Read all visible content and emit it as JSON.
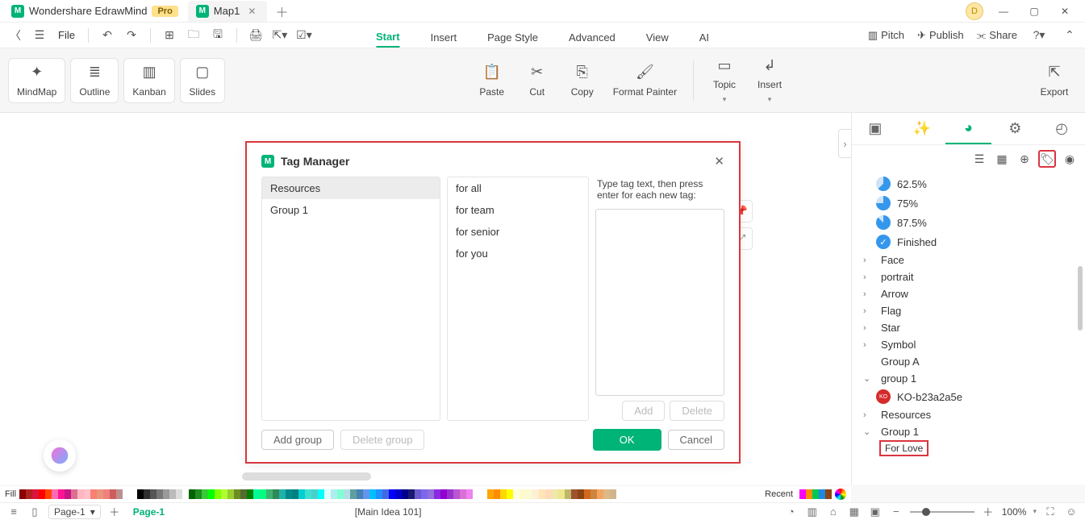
{
  "titlebar": {
    "app_name": "Wondershare EdrawMind",
    "pro_badge": "Pro",
    "tab_name": "Map1",
    "user_initial": "D"
  },
  "quickbar": {
    "file_label": "File"
  },
  "menubar": {
    "items": [
      "Start",
      "Insert",
      "Page Style",
      "Advanced",
      "View",
      "AI"
    ],
    "right_items": [
      "Pitch",
      "Publish",
      "Share"
    ]
  },
  "ribbon": {
    "view_buttons": [
      "MindMap",
      "Outline",
      "Kanban",
      "Slides"
    ],
    "clipboard": [
      "Paste",
      "Cut",
      "Copy",
      "Format Painter"
    ],
    "insert": [
      "Topic",
      "Insert"
    ],
    "export": "Export"
  },
  "right_panel": {
    "progress_items": [
      {
        "pct": "62.5%",
        "p": 62.5
      },
      {
        "pct": "75%",
        "p": 75
      },
      {
        "pct": "87.5%",
        "p": 87.5
      }
    ],
    "finished_label": "Finished",
    "cat_items": [
      "Face",
      "portrait",
      "Arrow",
      "Flag",
      "Star",
      "Symbol"
    ],
    "plain_items": [
      "Group A"
    ],
    "group1_label": "group 1",
    "ko_label": "KO-b23a2a5e",
    "resources_label": "Resources",
    "Group1_label": "Group 1",
    "forlove_label": "For Love"
  },
  "colorbar": {
    "fill_label": "Fill",
    "recent_label": "Recent"
  },
  "statusbar": {
    "page_select": "Page-1",
    "page_tab": "Page-1",
    "center": "[Main Idea 101]",
    "zoom": "100%"
  },
  "modal": {
    "title": "Tag Manager",
    "groups": [
      "Resources",
      "Group 1"
    ],
    "tags": [
      "for all",
      "for team",
      "for senior",
      "for you"
    ],
    "hint": "Type tag text, then press enter for each new tag:",
    "btn_add": "Add",
    "btn_delete": "Delete",
    "btn_add_group": "Add group",
    "btn_delete_group": "Delete group",
    "btn_ok": "OK",
    "btn_cancel": "Cancel"
  }
}
